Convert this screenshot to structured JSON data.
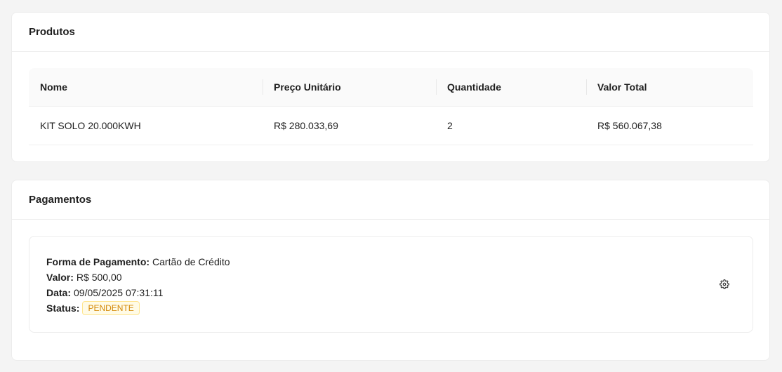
{
  "products": {
    "title": "Produtos",
    "columns": [
      "Nome",
      "Preço Unitário",
      "Quantidade",
      "Valor Total"
    ],
    "rows": [
      [
        "KIT SOLO 20.000KWH",
        "R$ 280.033,69",
        "2",
        "R$ 560.067,38"
      ]
    ]
  },
  "payments": {
    "title": "Pagamentos",
    "items": [
      {
        "method_label": "Forma de Pagamento:",
        "method_value": "Cartão de Crédito",
        "amount_label": "Valor:",
        "amount_value": "R$ 500,00",
        "date_label": "Data:",
        "date_value": "09/05/2025 07:31:11",
        "status_label": "Status:",
        "status_value": "PENDENTE",
        "action_icon": "gear-icon"
      }
    ]
  },
  "colors": {
    "page_bg": "#f4f4f4",
    "card_bg": "#ffffff",
    "status_pending_text": "#d48806",
    "status_pending_bg": "#fffbe6",
    "status_pending_border": "#ffe58f"
  }
}
